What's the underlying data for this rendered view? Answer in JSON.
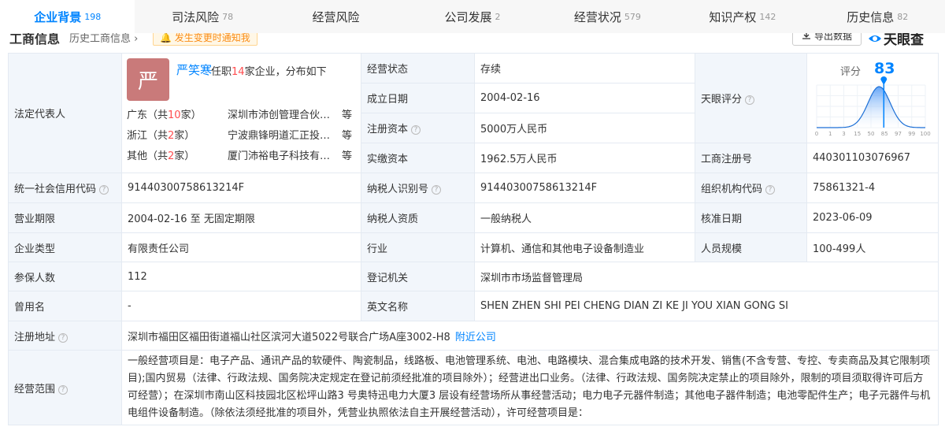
{
  "tabs": [
    {
      "label": "企业背景",
      "count": "198"
    },
    {
      "label": "司法风险",
      "count": "78"
    },
    {
      "label": "经营风险",
      "count": ""
    },
    {
      "label": "公司发展",
      "count": "2"
    },
    {
      "label": "经营状况",
      "count": "579"
    },
    {
      "label": "知识产权",
      "count": "142"
    },
    {
      "label": "历史信息",
      "count": "82"
    }
  ],
  "subheader": {
    "title": "工商信息",
    "history_link": "历史工商信息 ›",
    "notify_label": "发生变更时通知我",
    "export_label": "导出数据",
    "brand": "天眼查"
  },
  "legal_rep": {
    "label": "法定代表人",
    "avatar_char": "严",
    "name": "严笑寒",
    "jobs_prefix": "任职",
    "jobs_count": "14",
    "jobs_suffix": "家企业，分布如下",
    "regions": [
      {
        "prov": "广东（共",
        "n": "10",
        "unit": "家）",
        "company": "深圳市沛创管理合伙企业（有限合伙）",
        "more": "等"
      },
      {
        "prov": "浙江（共",
        "n": "2",
        "unit": "家）",
        "company": "宁波鼎锋明道汇正投资合伙企业",
        "more": "等"
      },
      {
        "prov": "其他（共",
        "n": "2",
        "unit": "家）",
        "company": "厦门沛裕电子科技有限公司",
        "more": "等"
      }
    ]
  },
  "info": {
    "status_label": "经营状态",
    "status": "存续",
    "found_label": "成立日期",
    "found": "2004-02-16",
    "capital_label": "注册资本",
    "capital": "5000万人民币",
    "paid_label": "实缴资本",
    "paid": "1962.5万人民币",
    "score_label": "天眼评分",
    "score_title": "评分",
    "score_value": "83",
    "score_ticks": [
      "0",
      "1",
      "3",
      "15",
      "50",
      "85",
      "97",
      "99",
      "100"
    ],
    "regno_label": "工商注册号",
    "regno": "440301103076967",
    "credit_label": "统一社会信用代码",
    "credit": "91440300758613214F",
    "taxid_label": "纳税人识别号",
    "taxid": "91440300758613214F",
    "org_label": "组织机构代码",
    "org": "75861321-4",
    "term_label": "营业期限",
    "term": "2004-02-16 至 无固定期限",
    "taxq_label": "纳税人资质",
    "taxq": "一般纳税人",
    "approve_label": "核准日期",
    "approve": "2023-06-09",
    "type_label": "企业类型",
    "type": "有限责任公司",
    "industry_label": "行业",
    "industry": "计算机、通信和其他电子设备制造业",
    "staff_label": "人员规模",
    "staff": "100-499人",
    "insured_label": "参保人数",
    "insured": "112",
    "authority_label": "登记机关",
    "authority": "深圳市市场监督管理局",
    "oldname_label": "曾用名",
    "oldname": "-",
    "en_label": "英文名称",
    "en": "SHEN ZHEN SHI PEI CHENG DIAN ZI KE JI YOU XIAN GONG SI",
    "addr_label": "注册地址",
    "addr": "深圳市福田区福田街道福山社区滨河大道5022号联合广场A座3002-H8",
    "nearby": "附近公司",
    "scope_label": "经营范围",
    "scope": "一般经营项目是：电子产品、通讯产品的软硬件、陶瓷制品，线路板、电池管理系统、电池、电路模块、混合集成电路的技术开发、销售(不含专营、专控、专卖商品及其它限制项目);国内贸易（法律、行政法规、国务院决定规定在登记前须经批准的项目除外）；经营进出口业务。（法律、行政法规、国务院决定禁止的项目除外，限制的项目须取得许可后方可经营）；在深圳市南山区科技园北区松坪山路3 号奥特迅电力大厦3 层设有经营场所从事经营活动；电力电子元器件制造；其他电子器件制造；电池零配件生产；电子元器件与机电组件设备制造。（除依法须经批准的项目外，凭营业执照依法自主开展经营活动），许可经营项目是："
  },
  "colors": {
    "accent": "#0084ff",
    "label_bg": "#f2f6fb",
    "avatar": "#c97a7a",
    "red": "#ff4d4f"
  }
}
